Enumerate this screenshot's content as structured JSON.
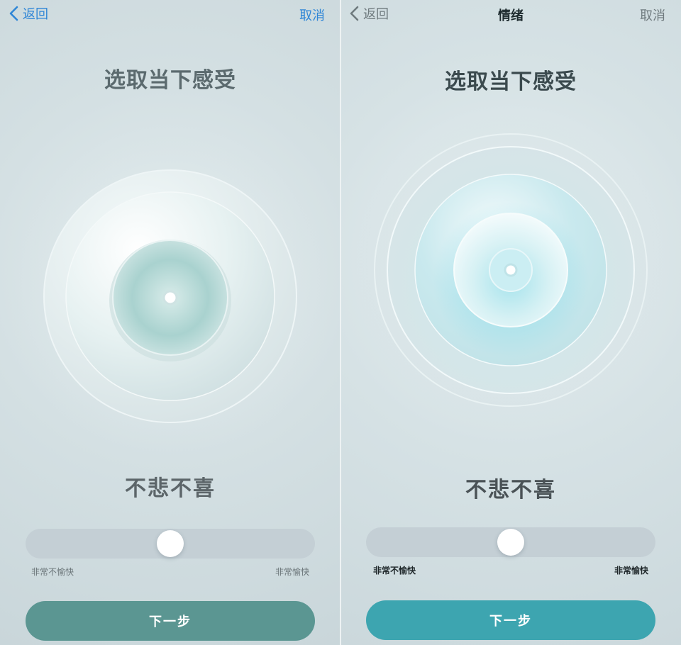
{
  "screens": [
    {
      "nav": {
        "back_label": "返回",
        "title": "",
        "cancel_label": "取消"
      },
      "heading": "选取当下感受",
      "mood_label": "不悲不喜",
      "slider": {
        "value": 0.5,
        "min_label": "非常不愉快",
        "max_label": "非常愉快"
      },
      "next_label": "下一步",
      "colors": {
        "accent": "#2f86d6",
        "button": "#5b9692",
        "dial_tint": "#8fcfcf"
      }
    },
    {
      "nav": {
        "back_label": "返回",
        "title": "情绪",
        "cancel_label": "取消"
      },
      "heading": "选取当下感受",
      "mood_label": "不悲不喜",
      "slider": {
        "value": 0.5,
        "min_label": "非常不愉快",
        "max_label": "非常愉快"
      },
      "next_label": "下一步",
      "colors": {
        "accent": "#6f7a7e",
        "button": "#3da5b0",
        "dial_tint": "#6fd6e4"
      }
    }
  ]
}
